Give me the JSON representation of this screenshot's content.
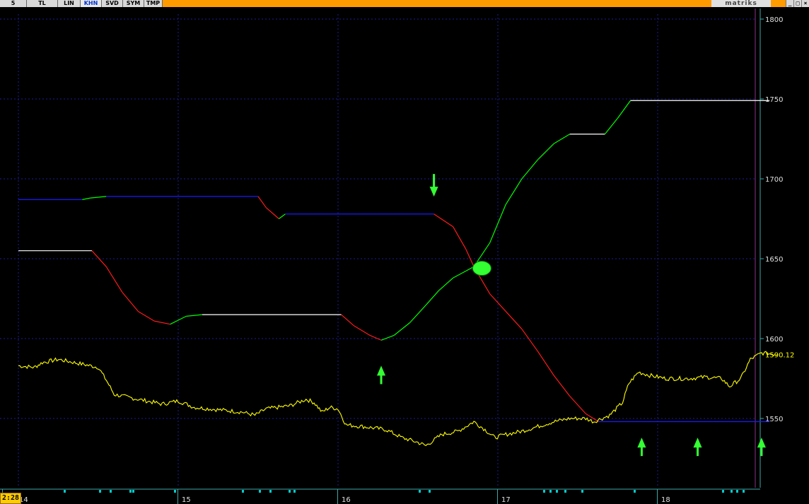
{
  "toolbar": {
    "buttons": [
      "5",
      "TL",
      "LIN",
      "KHN",
      "SVD",
      "SYM",
      "TMP"
    ],
    "active": "KHN",
    "brand": "matriks",
    "window_buttons": [
      "_",
      "□",
      "×"
    ]
  },
  "clock": "2:28",
  "colors": {
    "price": "#ffff00",
    "rising": "#00ff00",
    "falling": "#ff1a1a",
    "flat_long": "#ffffff",
    "flat_short": "#1a1aff",
    "grid": "#1c1c99",
    "marker": "#33ff33"
  },
  "chart_data": {
    "type": "line",
    "x_ticks": [
      "14",
      "15",
      "16",
      "17",
      "18"
    ],
    "ylim": [
      1500,
      1810
    ],
    "y_ticks": [
      1550,
      1600,
      1650,
      1700,
      1750,
      1800
    ],
    "grid": true,
    "last_value": "1590.12",
    "series": [
      {
        "role": "upper-band",
        "points": [
          [
            0.0,
            1687
          ],
          [
            0.4,
            1687
          ],
          [
            0.45,
            1688
          ],
          [
            0.55,
            1689
          ],
          [
            1.5,
            1689
          ],
          [
            1.55,
            1682
          ],
          [
            1.63,
            1675
          ],
          [
            1.67,
            1678
          ],
          [
            2.6,
            1678
          ],
          [
            2.72,
            1670
          ],
          [
            2.8,
            1656
          ],
          [
            2.85,
            1645
          ],
          [
            2.95,
            1628
          ],
          [
            3.05,
            1617
          ],
          [
            3.15,
            1606
          ],
          [
            3.25,
            1592
          ],
          [
            3.35,
            1577
          ],
          [
            3.45,
            1564
          ],
          [
            3.55,
            1553
          ],
          [
            3.63,
            1548
          ],
          [
            4.5,
            1548
          ],
          [
            4.7,
            1548
          ]
        ]
      },
      {
        "role": "lower-band",
        "points": [
          [
            0.0,
            1655
          ],
          [
            0.46,
            1655
          ],
          [
            0.55,
            1645
          ],
          [
            0.65,
            1629
          ],
          [
            0.75,
            1617
          ],
          [
            0.85,
            1611
          ],
          [
            0.95,
            1609
          ],
          [
            1.05,
            1614
          ],
          [
            1.15,
            1615
          ],
          [
            2.02,
            1615
          ],
          [
            2.1,
            1608
          ],
          [
            2.2,
            1602
          ],
          [
            2.27,
            1599
          ],
          [
            2.35,
            1602
          ],
          [
            2.45,
            1610
          ],
          [
            2.55,
            1621
          ],
          [
            2.63,
            1630
          ],
          [
            2.72,
            1638
          ],
          [
            2.85,
            1645
          ],
          [
            2.95,
            1660
          ],
          [
            3.05,
            1684
          ],
          [
            3.15,
            1700
          ],
          [
            3.25,
            1712
          ],
          [
            3.35,
            1722
          ],
          [
            3.45,
            1728
          ],
          [
            3.67,
            1728
          ],
          [
            3.75,
            1738
          ],
          [
            3.83,
            1749
          ],
          [
            4.7,
            1749
          ]
        ]
      },
      {
        "role": "price",
        "points": [
          [
            0.0,
            1583
          ],
          [
            0.1,
            1582
          ],
          [
            0.15,
            1585
          ],
          [
            0.25,
            1587
          ],
          [
            0.35,
            1585
          ],
          [
            0.5,
            1582
          ],
          [
            0.55,
            1574
          ],
          [
            0.6,
            1565
          ],
          [
            0.7,
            1563
          ],
          [
            0.8,
            1561
          ],
          [
            0.9,
            1559
          ],
          [
            1.0,
            1561
          ],
          [
            1.1,
            1557
          ],
          [
            1.2,
            1556
          ],
          [
            1.3,
            1555
          ],
          [
            1.4,
            1554
          ],
          [
            1.48,
            1552
          ],
          [
            1.55,
            1556
          ],
          [
            1.7,
            1558
          ],
          [
            1.8,
            1562
          ],
          [
            1.85,
            1560
          ],
          [
            1.9,
            1554
          ],
          [
            1.95,
            1557
          ],
          [
            2.0,
            1556
          ],
          [
            2.05,
            1546
          ],
          [
            2.15,
            1545
          ],
          [
            2.3,
            1543
          ],
          [
            2.4,
            1538
          ],
          [
            2.5,
            1535
          ],
          [
            2.55,
            1533
          ],
          [
            2.65,
            1540
          ],
          [
            2.75,
            1542
          ],
          [
            2.85,
            1548
          ],
          [
            2.92,
            1543
          ],
          [
            2.98,
            1538
          ],
          [
            3.05,
            1540
          ],
          [
            3.15,
            1542
          ],
          [
            3.25,
            1545
          ],
          [
            3.35,
            1548
          ],
          [
            3.45,
            1550
          ],
          [
            3.55,
            1550
          ],
          [
            3.6,
            1548
          ],
          [
            3.7,
            1552
          ],
          [
            3.78,
            1560
          ],
          [
            3.82,
            1572
          ],
          [
            3.88,
            1579
          ],
          [
            3.95,
            1577
          ],
          [
            4.05,
            1575
          ],
          [
            4.2,
            1575
          ],
          [
            4.3,
            1576
          ],
          [
            4.4,
            1575
          ],
          [
            4.45,
            1570
          ],
          [
            4.52,
            1575
          ],
          [
            4.58,
            1587
          ],
          [
            4.65,
            1591
          ],
          [
            4.75,
            1590
          ]
        ]
      }
    ],
    "annotations": [
      {
        "type": "arrow-down",
        "x": 2.6,
        "y": 1688
      },
      {
        "type": "arrow-up",
        "x": 2.27,
        "y": 1583
      },
      {
        "type": "arrow-up",
        "x": 3.9,
        "y": 1538
      },
      {
        "type": "arrow-up",
        "x": 4.25,
        "y": 1538
      },
      {
        "type": "arrow-up",
        "x": 4.65,
        "y": 1538
      },
      {
        "type": "crossover",
        "x": 2.9,
        "y": 1644
      }
    ]
  }
}
